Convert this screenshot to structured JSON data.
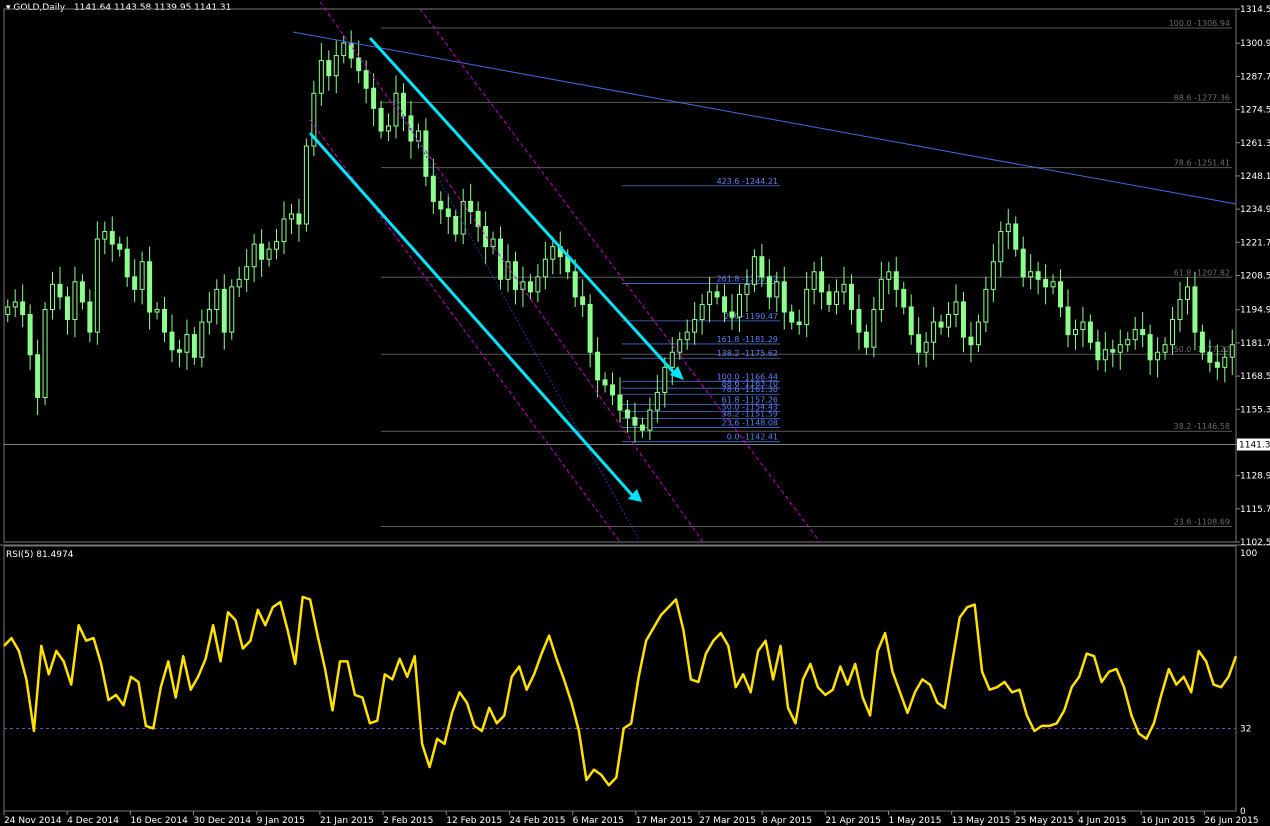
{
  "header": {
    "symbol": "GOLD,Daily",
    "ohlc": "1141.64 1143.58 1139.95 1141.31"
  },
  "rsi_header": "RSI(5) 81.4974",
  "colors": {
    "bg": "#000000",
    "candle": "#8CFF8C",
    "cyan": "#00E5FF",
    "trend": "#4169E1",
    "magenta": "#C800C8",
    "rsi": "#FFE100",
    "fib": "#4a6fd8",
    "grid": "#3a3a3a"
  },
  "chart_data": [
    {
      "type": "candlestick",
      "title": "GOLD,Daily",
      "ylim": [
        1102.52,
        1314.52
      ],
      "price_ticks": [
        "1314.52",
        "1300.92",
        "1287.72",
        "1274.52",
        "1261.32",
        "1248.12",
        "1234.92",
        "1221.72",
        "1208.52",
        "1194.92",
        "1181.72",
        "1168.52",
        "1155.32",
        "1141.3",
        "1128.92",
        "1115.72",
        "1102.52"
      ],
      "current_price": "1141.3",
      "x_labels": [
        "24 Nov 2014",
        "4 Dec 2014",
        "16 Dec 2014",
        "30 Dec 2014",
        "9 Jan 2015",
        "21 Jan 2015",
        "2 Feb 2015",
        "12 Feb 2015",
        "24 Feb 2015",
        "6 Mar 2015",
        "17 Mar 2015",
        "27 Mar 2015",
        "8 Apr 2015",
        "21 Apr 2015",
        "1 May 2015",
        "13 May 2015",
        "25 May 2015",
        "4 Jun 2015",
        "16 Jun 2015",
        "26 Jun 2015"
      ],
      "close_series": [
        1196,
        1198,
        1193,
        1177,
        1160,
        1195,
        1205,
        1200,
        1191,
        1206,
        1198,
        1186,
        1223,
        1226,
        1221,
        1219,
        1208,
        1203,
        1214,
        1194,
        1195,
        1186,
        1179,
        1178,
        1185,
        1176,
        1190,
        1195,
        1203,
        1186,
        1204,
        1207,
        1212,
        1221,
        1215,
        1219,
        1222,
        1231,
        1233,
        1229,
        1260,
        1281,
        1294,
        1288,
        1296,
        1301,
        1295,
        1290,
        1283,
        1275,
        1266,
        1268,
        1281,
        1272,
        1262,
        1266,
        1248,
        1238,
        1235,
        1232,
        1225,
        1238,
        1234,
        1228,
        1220,
        1223,
        1207,
        1214,
        1203,
        1206,
        1202,
        1208,
        1215,
        1220,
        1216,
        1210,
        1200,
        1197,
        1178,
        1167,
        1165,
        1161,
        1155,
        1152,
        1149,
        1147,
        1155,
        1162,
        1172,
        1178,
        1183,
        1186,
        1191,
        1197,
        1202,
        1200,
        1194,
        1192,
        1201,
        1205,
        1216,
        1208,
        1200,
        1206,
        1194,
        1190,
        1189,
        1203,
        1210,
        1202,
        1197,
        1202,
        1205,
        1195,
        1186,
        1180,
        1195,
        1207,
        1210,
        1203,
        1196,
        1185,
        1178,
        1182,
        1190,
        1188,
        1193,
        1198,
        1184,
        1181,
        1190,
        1203,
        1214,
        1226,
        1229,
        1219,
        1208,
        1210,
        1207,
        1204,
        1206,
        1196,
        1185,
        1187,
        1190,
        1182,
        1175,
        1179,
        1178,
        1181,
        1183,
        1187,
        1185,
        1175,
        1178,
        1181,
        1191,
        1199,
        1204,
        1186,
        1178,
        1174,
        1172,
        1176,
        1181
      ],
      "fib_levels": [
        {
          "label": "100.0 -1306.94",
          "value": 1306.94
        },
        {
          "label": "88.6 -1277.36",
          "value": 1277.36
        },
        {
          "label": "78.6 -1251.41",
          "value": 1251.41
        },
        {
          "label": "61.8 -1207.82",
          "value": 1207.82
        },
        {
          "label": "50.0 -1177.22",
          "value": 1177.22
        },
        {
          "label": "38.2 -1146.58",
          "value": 1146.58
        },
        {
          "label": "23.6 -1108.69",
          "value": 1108.69
        }
      ],
      "fib_ext_levels": [
        {
          "label": "423.6 -1244.21",
          "value": 1244.21
        },
        {
          "label": "261.8 -1205.32",
          "value": 1205.32
        },
        {
          "label": "200 -1190.47",
          "value": 1190.47
        },
        {
          "label": "161.8 -1181.29",
          "value": 1181.29
        },
        {
          "label": "138.2 -1175.62",
          "value": 1175.62
        },
        {
          "label": "100.0 -1166.44",
          "value": 1166.44
        },
        {
          "label": "88.6 -1163.70",
          "value": 1163.7
        },
        {
          "label": "78.6 -1161.30",
          "value": 1161.3
        },
        {
          "label": "61.8 -1157.26",
          "value": 1157.26
        },
        {
          "label": "50.0 -1154.43",
          "value": 1154.43
        },
        {
          "label": "38.2 -1151.59",
          "value": 1151.59
        },
        {
          "label": "23.6 -1148.08",
          "value": 1148.08
        },
        {
          "label": "0.0 -1142.41",
          "value": 1142.41
        }
      ]
    },
    {
      "type": "line",
      "title": "RSI(5) 81.4974",
      "ylim": [
        0,
        100
      ],
      "y_ticks": [
        "100",
        "32",
        "0"
      ],
      "level": 32,
      "values": [
        64,
        67,
        62,
        51,
        31,
        64,
        53,
        62,
        58,
        49,
        72,
        66,
        67,
        57,
        43,
        45,
        41,
        52,
        50,
        33,
        32,
        48,
        58,
        44,
        60,
        47,
        52,
        59,
        72,
        58,
        77,
        74,
        63,
        66,
        78,
        72,
        79,
        81,
        70,
        57,
        83,
        82,
        68,
        55,
        39,
        58,
        58,
        45,
        44,
        34,
        35,
        53,
        51,
        59,
        52,
        60,
        26,
        17,
        28,
        26,
        38,
        46,
        42,
        33,
        31,
        40,
        34,
        37,
        52,
        56,
        47,
        53,
        61,
        68,
        59,
        51,
        42,
        31,
        12,
        16,
        14,
        10,
        13,
        32,
        34,
        52,
        66,
        71,
        76,
        79,
        82,
        70,
        51,
        50,
        61,
        66,
        69,
        64,
        48,
        53,
        46,
        62,
        66,
        51,
        64,
        40,
        34,
        51,
        57,
        48,
        45,
        47,
        56,
        49,
        57,
        44,
        37,
        62,
        69,
        54,
        46,
        38,
        46,
        51,
        49,
        42,
        40,
        58,
        75,
        79,
        80,
        54,
        47,
        48,
        50,
        46,
        47,
        37,
        31,
        33,
        33,
        34,
        39,
        48,
        52,
        61,
        60,
        50,
        54,
        55,
        48,
        37,
        30,
        28,
        34,
        45,
        55,
        49,
        52,
        46,
        62,
        58,
        49,
        48,
        52,
        60
      ]
    }
  ]
}
